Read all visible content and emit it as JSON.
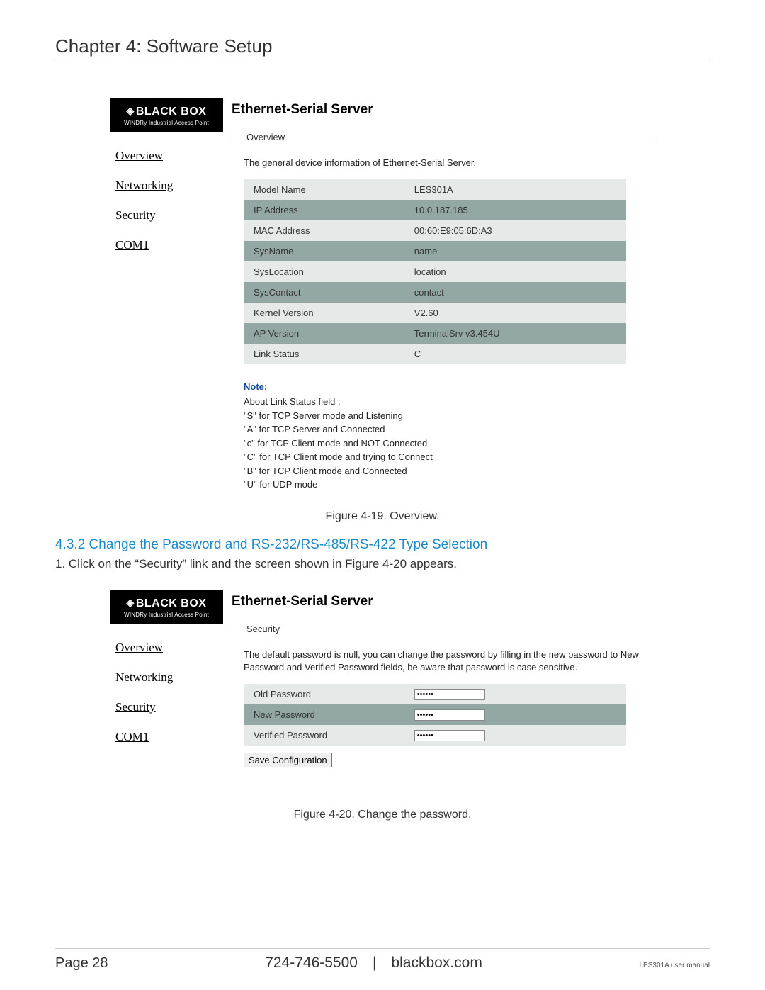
{
  "chapter_title": "Chapter 4: Software Setup",
  "brand": {
    "name": "BLACK BOX",
    "tagline": "WINDRy Industrial Access Point"
  },
  "nav": {
    "items": [
      "Overview",
      "Networking",
      "Security",
      "COM1"
    ]
  },
  "overview": {
    "page_title": "Ethernet-Serial Server",
    "legend": "Overview",
    "intro": "The general device information of Ethernet-Serial Server.",
    "rows": [
      {
        "label": "Model Name",
        "value": "LES301A"
      },
      {
        "label": "IP Address",
        "value": "10.0.187.185"
      },
      {
        "label": "MAC Address",
        "value": "00:60:E9:05:6D:A3"
      },
      {
        "label": "SysName",
        "value": "name"
      },
      {
        "label": "SysLocation",
        "value": "location"
      },
      {
        "label": "SysContact",
        "value": "contact"
      },
      {
        "label": "Kernel Version",
        "value": "V2.60"
      },
      {
        "label": "AP Version",
        "value": "TerminalSrv v3.454U"
      },
      {
        "label": "Link Status",
        "value": "C"
      }
    ],
    "note_title": "Note:",
    "note_lines": [
      "About Link Status field :",
      "\"S\" for TCP Server mode and Listening",
      "\"A\" for TCP Server and Connected",
      "\"c\" for TCP Client mode and NOT Connected",
      "\"C\" for TCP Client mode and trying to Connect",
      "\"B\" for TCP Client mode and Connected",
      "\"U\" for UDP mode"
    ]
  },
  "fig19_caption": "Figure 4-19. Overview.",
  "section_432": {
    "heading": "4.3.2 Change the Password and RS-232/RS-485/RS-422 Type Selection",
    "step1": "1. Click on the “Security” link and the screen shown in Figure 4-20 appears."
  },
  "security": {
    "page_title": "Ethernet-Serial Server",
    "legend": "Security",
    "intro": "The default password is null, you can change the password by filling in the new password to New Password and Verified Password fields, be aware that password is case sensitive.",
    "rows": [
      {
        "label": "Old Password",
        "value": "••••••"
      },
      {
        "label": "New Password",
        "value": "••••••"
      },
      {
        "label": "Verified Password",
        "value": "••••••"
      }
    ],
    "save_label": "Save Configuration"
  },
  "fig20_caption": "Figure 4-20. Change the password.",
  "footer": {
    "page": "Page 28",
    "center": "724-746-5500 | blackbox.com",
    "right": "LES301A user manual"
  }
}
